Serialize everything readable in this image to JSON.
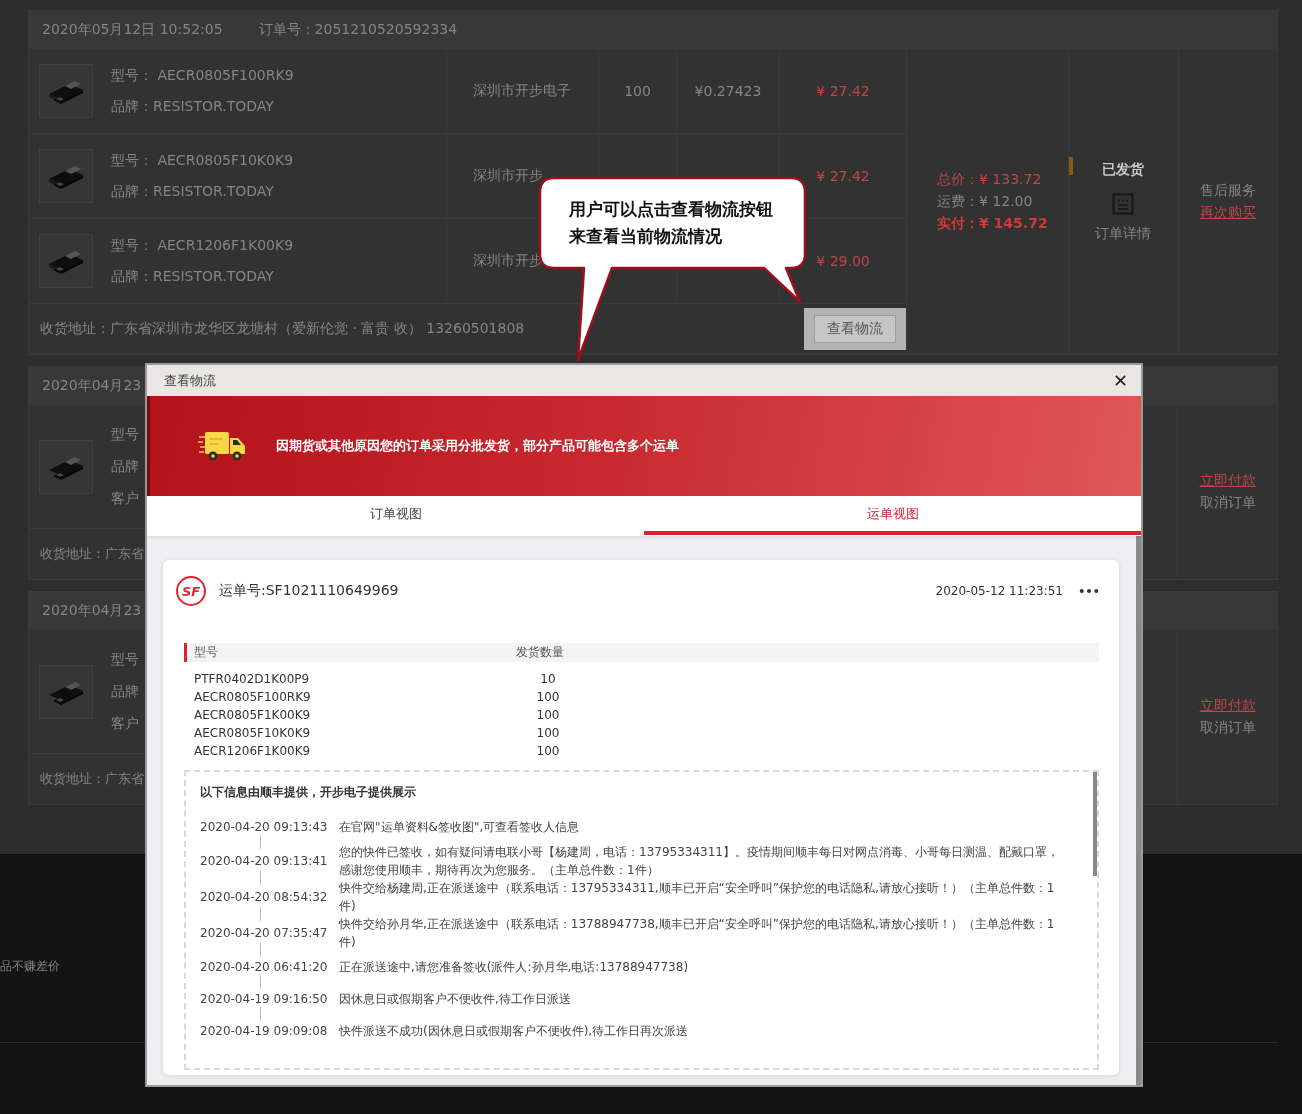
{
  "orders": [
    {
      "kind": "full",
      "date": "2020年05月12日 10:52:05",
      "order_label": "订单号：",
      "order_no": "2051210520592334",
      "items": [
        {
          "model_label": "型号：",
          "model": "AECR0805F100RK9",
          "brand_label": "品牌：",
          "brand": "RESISTOR.TODAY",
          "supplier": "深圳市开步电子",
          "qty": "100",
          "unit_price": "¥0.27423",
          "subtotal": "¥ 27.42"
        },
        {
          "model_label": "型号：",
          "model": "AECR0805F10K0K9",
          "brand_label": "品牌：",
          "brand": "RESISTOR.TODAY",
          "supplier": "深圳市开步",
          "subtotal": "¥ 27.42"
        },
        {
          "model_label": "型号：",
          "model": "AECR1206F1K00K9",
          "brand_label": "品牌：",
          "brand": "RESISTOR.TODAY",
          "supplier": "深圳市开步",
          "subtotal": "¥ 29.00"
        }
      ],
      "totals": [
        {
          "label": "总价：",
          "value": "¥ 133.72",
          "kind": "price"
        },
        {
          "label": "运费：",
          "value": "¥ 12.00",
          "kind": "plain"
        },
        {
          "label": "实付：",
          "value": "¥ 145.72",
          "kind": "paid"
        }
      ],
      "status": "已发货",
      "detail_link": "订单详情",
      "actions": [
        {
          "label": "售后服务",
          "kind": "plain"
        },
        {
          "label": "再次购买",
          "kind": "link"
        }
      ],
      "address": "收货地址：广东省深圳市龙华区龙塘村（爱新伦觉 · 富贵 收） 13260501808",
      "track_button": "查看物流"
    },
    {
      "kind": "partial",
      "date": "2020年04月23",
      "item_labels": [
        "型号",
        "品牌",
        "客户"
      ],
      "actions": [
        {
          "label": "立即付款",
          "kind": "link"
        },
        {
          "label": "取消订单",
          "kind": "plain"
        }
      ],
      "address": "收货地址：广东省"
    },
    {
      "kind": "partial",
      "date": "2020年04月23",
      "item_labels": [
        "型号",
        "品牌",
        "客户"
      ],
      "actions": [
        {
          "label": "立即付款",
          "kind": "link"
        },
        {
          "label": "取消订单",
          "kind": "plain"
        }
      ],
      "address": "收货地址：广东省"
    }
  ],
  "footer": {
    "text": "品不赚差价"
  },
  "callout": {
    "lines": [
      "用户可以点击查看物流按钮",
      "来查看当前物流情况"
    ]
  },
  "modal": {
    "title": "查看物流",
    "banner": "因期货或其他原因您的订单采用分批发货，部分产品可能包含多个运单",
    "tabs": [
      {
        "label": "订单视图",
        "selected": false
      },
      {
        "label": "运单视图",
        "selected": true
      }
    ],
    "waybill": {
      "logo_text": "SF",
      "number": "运单号:SF1021110649969",
      "time": "2020-05-12 11:23:51",
      "columns": [
        "型号",
        "发货数量"
      ],
      "rows": [
        {
          "model": "PTFR0402D1K00P9",
          "qty": "10"
        },
        {
          "model": "AECR0805F100RK9",
          "qty": "100"
        },
        {
          "model": "AECR0805F1K00K9",
          "qty": "100"
        },
        {
          "model": "AECR0805F10K0K9",
          "qty": "100"
        },
        {
          "model": "AECR1206F1K00K9",
          "qty": "100"
        }
      ],
      "tracking_title": "以下信息由顺丰提供，开步电子提供展示",
      "events": [
        {
          "time": "2020-04-20 09:13:43",
          "text": "在官网\"运单资料&签收图\",可查看签收人信息"
        },
        {
          "time": "2020-04-20 09:13:41",
          "text": "您的快件已签收，如有疑问请电联小哥【杨建周，电话：13795334311】。疫情期间顺丰每日对网点消毒、小哥每日测温、配戴口罩，感谢您使用顺丰，期待再次为您服务。（主单总件数：1件）"
        },
        {
          "time": "2020-04-20 08:54:32",
          "text": "快件交给杨建周,正在派送途中（联系电话：13795334311,顺丰已开启“安全呼叫”保护您的电话隐私,请放心接听！）（主单总件数：1件)"
        },
        {
          "time": "2020-04-20 07:35:47",
          "text": "快件交给孙月华,正在派送途中（联系电话：13788947738,顺丰已开启“安全呼叫”保护您的电话隐私,请放心接听！）（主单总件数：1件)"
        },
        {
          "time": "2020-04-20 06:41:20",
          "text": "正在派送途中,请您准备签收(派件人:孙月华,电话:13788947738)"
        },
        {
          "time": "2020-04-19 09:16:50",
          "text": "因休息日或假期客户不便收件,待工作日派送"
        },
        {
          "time": "2020-04-19 09:09:08",
          "text": "快件派送不成功(因休息日或假期客户不便收件),待工作日再次派送"
        }
      ]
    }
  }
}
